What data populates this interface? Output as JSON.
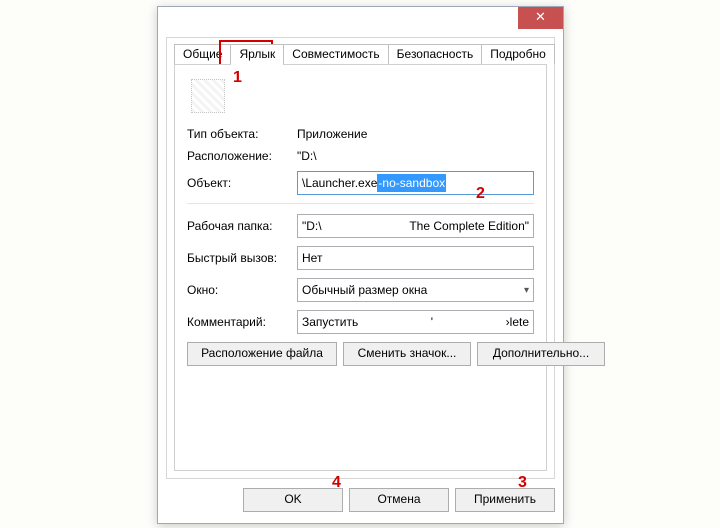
{
  "titlebar": {
    "close": "✕"
  },
  "tabs": [
    {
      "label": "Общие"
    },
    {
      "label": "Ярлык",
      "active": true
    },
    {
      "label": "Совместимость"
    },
    {
      "label": "Безопасность"
    },
    {
      "label": "Подробно"
    }
  ],
  "fields": {
    "type_label": "Тип объекта:",
    "type_value": "Приложение",
    "location_label": "Расположение:",
    "location_value": "\"D:\\",
    "target_label": "Объект:",
    "target_value_prefix": "\\Launcher.exe ",
    "target_value_selected": "-no-sandbox",
    "workdir_label": "Рабочая папка:",
    "workdir_value_left": "\"D:\\",
    "workdir_value_right": "The Complete Edition\"",
    "shortcut_label": "Быстрый вызов:",
    "shortcut_value": "Нет",
    "window_label": "Окно:",
    "window_value": "Обычный размер окна",
    "comment_label": "Комментарий:",
    "comment_value_left": "Запустить",
    "comment_value_right": "›lete"
  },
  "buttons": {
    "open_location": "Расположение файла",
    "change_icon": "Сменить значок...",
    "advanced": "Дополнительно..."
  },
  "footer": {
    "ok": "OK",
    "cancel": "Отмена",
    "apply": "Применить"
  },
  "annotations": {
    "a1": "1",
    "a2": "2",
    "a3": "3",
    "a4": "4"
  }
}
